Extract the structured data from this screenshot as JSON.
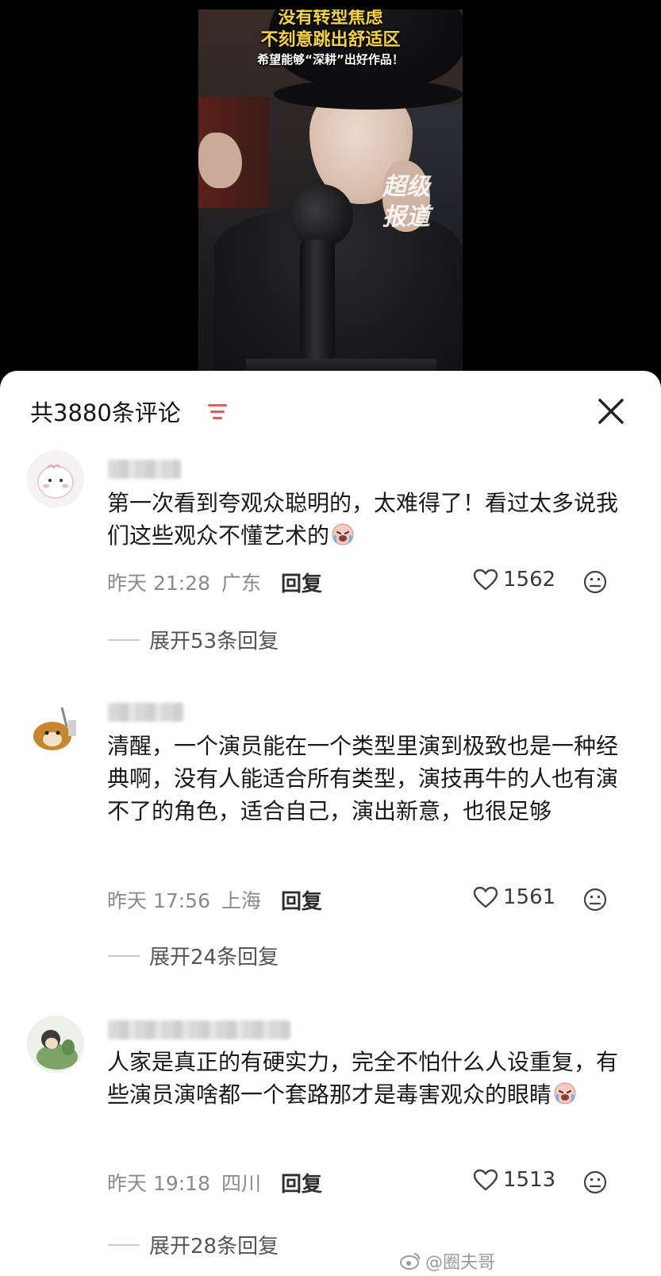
{
  "video": {
    "caption_line1": "没有转型焦虑",
    "caption_line2": "不刻意跳出舒适区",
    "caption_line3": "希望能够“深耕”出好作品！",
    "watermark": "超级报道"
  },
  "header": {
    "title": "共3880条评论",
    "sort_icon": "sort-icon",
    "close_icon": "close-icon"
  },
  "comments": [
    {
      "text": "第一次看到夸观众聪明的，太难得了！看过太多说我们这些观众不懂艺术的",
      "emoji": "crying-laughing-emoji",
      "time": "昨天 21:28",
      "location": "广东",
      "reply_label": "回复",
      "likes": "1562",
      "expand_label": "展开53条回复"
    },
    {
      "text": "清醒，一个演员能在一个类型里演到极致也是一种经典啊，没有人能适合所有类型，演技再牛的人也有演不了的角色，适合自己，演出新意，也很足够",
      "time": "昨天 17:56",
      "location": "上海",
      "reply_label": "回复",
      "likes": "1561",
      "expand_label": "展开24条回复"
    },
    {
      "text": "人家是真正的有硬实力，完全不怕什么人设重复，有些演员演啥都一个套路那才是毒害观众的眼睛",
      "emoji": "crying-laughing-emoji",
      "time": "昨天 19:18",
      "location": "四川",
      "reply_label": "回复",
      "likes": "1513",
      "expand_label": "展开28条回复"
    }
  ],
  "footer": {
    "watermark": "@圈夫哥"
  }
}
